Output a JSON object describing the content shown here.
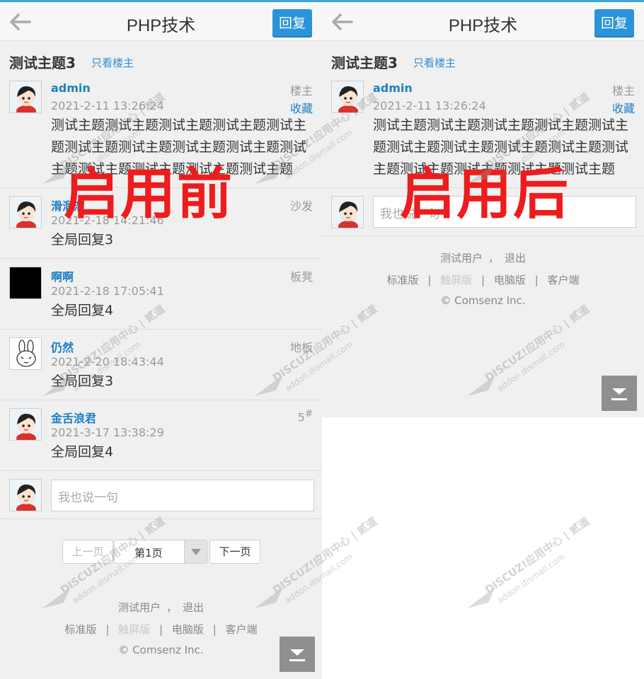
{
  "panels": {
    "before": {
      "header": {
        "title": "PHP技术",
        "reply_button": "回复"
      },
      "thread": {
        "title": "测试主题3",
        "only_author": "只看楼主"
      },
      "posts": [
        {
          "author": "admin",
          "time": "2021-2-11 13:26:24",
          "floor": "楼主",
          "favorite": "收藏",
          "content": "测试主题测试主题测试主题测试主题测试主题测试主题测试主题测试主题测试主题测试主题测试主题测试主题测试主题测试主题"
        },
        {
          "author": "滑溜溜",
          "time": "2021-2-18 14:21:46",
          "floor": "沙发",
          "content": "全局回复3"
        },
        {
          "author": "啊啊",
          "time": "2021-2-18 17:05:41",
          "floor": "板凳",
          "content": "全局回复4"
        },
        {
          "author": "仍然",
          "time": "2021-2-20 18:43:44",
          "floor": "地板",
          "content": "全局回复3"
        },
        {
          "author": "金舌浪君",
          "time": "2021-3-17 13:38:29",
          "floor": "5",
          "floor_sup": "#",
          "content": "全局回复4"
        }
      ],
      "reply_placeholder": "我也说一句",
      "pager": {
        "prev": "上一页",
        "current": "第1页",
        "next": "下一页"
      },
      "footer": {
        "user": "测试用户",
        "comma": "，",
        "logout": "退出",
        "standard": "标准版",
        "touch": "触屏版",
        "pc": "电脑版",
        "client": "客户端",
        "sep": "|",
        "copyright": "© Comsenz Inc."
      },
      "overlay": "启用前"
    },
    "after": {
      "header": {
        "title": "PHP技术",
        "reply_button": "回复"
      },
      "thread": {
        "title": "测试主题3",
        "only_author": "只看楼主"
      },
      "post": {
        "author": "admin",
        "time": "2021-2-11 13:26:24",
        "floor": "楼主",
        "favorite": "收藏",
        "content": "测试主题测试主题测试主题测试主题测试主题测试主题测试主题测试主题测试主题测试主题测试主题测试主题测试主题测试主题"
      },
      "reply_placeholder": "我也说一句",
      "footer": {
        "user": "测试用户",
        "comma": "，",
        "logout": "退出",
        "standard": "标准版",
        "touch": "触屏版",
        "pc": "电脑版",
        "client": "客户端",
        "sep": "|",
        "copyright": "© Comsenz Inc."
      },
      "overlay": "启用后"
    }
  },
  "watermark": {
    "line1": "DISCUZ!应用中心 | 贰道",
    "line2": "addon.dismall.com"
  },
  "colors": {
    "accent": "#2b93d9",
    "link": "#1a7fc4",
    "overlay": "#ee1c1c"
  }
}
